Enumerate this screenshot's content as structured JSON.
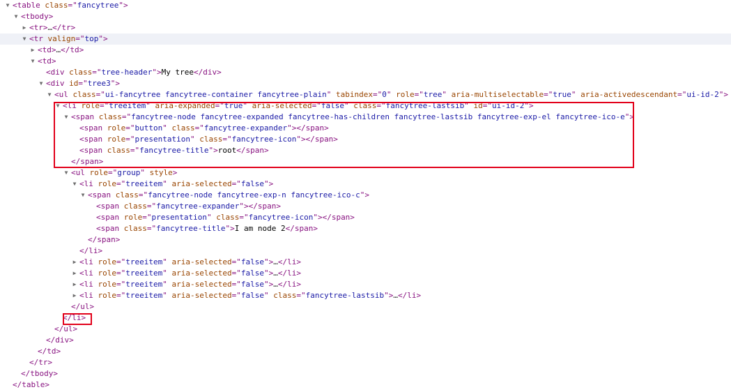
{
  "panel": "Elements",
  "highlight_color": "#e2001a",
  "colors": {
    "tag": "#881280",
    "attr_name": "#994500",
    "attr_value": "#1a1aa6",
    "text": "#000000",
    "selected_row_bg": "#eff1f7"
  },
  "nodes": [
    {
      "d": 0,
      "a": "open",
      "s": [
        [
          "t",
          "<table "
        ],
        [
          "n",
          "class"
        ],
        [
          "t",
          "=\""
        ],
        [
          "v",
          "fancytree"
        ],
        [
          "t",
          "\">"
        ]
      ]
    },
    {
      "d": 1,
      "a": "open",
      "s": [
        [
          "t",
          "<tbody>"
        ]
      ]
    },
    {
      "d": 2,
      "a": "closed",
      "s": [
        [
          "t",
          "<tr>"
        ],
        [
          "e",
          "…"
        ],
        [
          "t",
          "</tr>"
        ]
      ]
    },
    {
      "d": 2,
      "a": "open",
      "sel": true,
      "s": [
        [
          "t",
          "<tr "
        ],
        [
          "n",
          "valign"
        ],
        [
          "t",
          "=\""
        ],
        [
          "v",
          "top"
        ],
        [
          "t",
          "\">"
        ]
      ]
    },
    {
      "d": 3,
      "a": "closed",
      "s": [
        [
          "t",
          "<td>"
        ],
        [
          "e",
          "…"
        ],
        [
          "t",
          "</td>"
        ]
      ]
    },
    {
      "d": 3,
      "a": "open",
      "s": [
        [
          "t",
          "<td>"
        ]
      ]
    },
    {
      "d": 4,
      "a": "none",
      "s": [
        [
          "t",
          "<div "
        ],
        [
          "n",
          "class"
        ],
        [
          "t",
          "=\""
        ],
        [
          "v",
          "tree-header"
        ],
        [
          "t",
          "\">"
        ],
        [
          "x",
          "My tree"
        ],
        [
          "t",
          "</div>"
        ]
      ]
    },
    {
      "d": 4,
      "a": "open",
      "s": [
        [
          "t",
          "<div "
        ],
        [
          "n",
          "id"
        ],
        [
          "t",
          "=\""
        ],
        [
          "v",
          "tree3"
        ],
        [
          "t",
          "\">"
        ]
      ]
    },
    {
      "d": 5,
      "a": "open",
      "s": [
        [
          "t",
          "<ul "
        ],
        [
          "n",
          "class"
        ],
        [
          "t",
          "=\""
        ],
        [
          "v",
          "ui-fancytree fancytree-container fancytree-plain"
        ],
        [
          "t",
          "\" "
        ],
        [
          "n",
          "tabindex"
        ],
        [
          "t",
          "=\""
        ],
        [
          "v",
          "0"
        ],
        [
          "t",
          "\" "
        ],
        [
          "n",
          "role"
        ],
        [
          "t",
          "=\""
        ],
        [
          "v",
          "tree"
        ],
        [
          "t",
          "\" "
        ],
        [
          "n",
          "aria-multiselectable"
        ],
        [
          "t",
          "=\""
        ],
        [
          "v",
          "true"
        ],
        [
          "t",
          "\" "
        ],
        [
          "n",
          "aria-activedescendant"
        ],
        [
          "t",
          "=\""
        ],
        [
          "v",
          "ui-id-2"
        ],
        [
          "t",
          "\">"
        ]
      ]
    },
    {
      "d": 6,
      "a": "open",
      "s": [
        [
          "t",
          "<li "
        ],
        [
          "n",
          "role"
        ],
        [
          "t",
          "=\""
        ],
        [
          "v",
          "treeitem"
        ],
        [
          "t",
          "\" "
        ],
        [
          "n",
          "aria-expanded"
        ],
        [
          "t",
          "=\""
        ],
        [
          "v",
          "true"
        ],
        [
          "t",
          "\" "
        ],
        [
          "n",
          "aria-selected"
        ],
        [
          "t",
          "=\""
        ],
        [
          "v",
          "false"
        ],
        [
          "t",
          "\" "
        ],
        [
          "n",
          "class"
        ],
        [
          "t",
          "=\""
        ],
        [
          "v",
          "fancytree-lastsib"
        ],
        [
          "t",
          "\" "
        ],
        [
          "n",
          "id"
        ],
        [
          "t",
          "=\""
        ],
        [
          "v",
          "ui-id-2"
        ],
        [
          "t",
          "\">"
        ]
      ]
    },
    {
      "d": 7,
      "a": "open",
      "s": [
        [
          "t",
          "<span "
        ],
        [
          "n",
          "class"
        ],
        [
          "t",
          "=\""
        ],
        [
          "v",
          "fancytree-node fancytree-expanded fancytree-has-children fancytree-lastsib fancytree-exp-el fancytree-ico-e"
        ],
        [
          "t",
          "\">"
        ]
      ]
    },
    {
      "d": 8,
      "a": "none",
      "s": [
        [
          "t",
          "<span "
        ],
        [
          "n",
          "role"
        ],
        [
          "t",
          "=\""
        ],
        [
          "v",
          "button"
        ],
        [
          "t",
          "\" "
        ],
        [
          "n",
          "class"
        ],
        [
          "t",
          "=\""
        ],
        [
          "v",
          "fancytree-expander"
        ],
        [
          "t",
          "\"></span>"
        ]
      ]
    },
    {
      "d": 8,
      "a": "none",
      "s": [
        [
          "t",
          "<span "
        ],
        [
          "n",
          "role"
        ],
        [
          "t",
          "=\""
        ],
        [
          "v",
          "presentation"
        ],
        [
          "t",
          "\" "
        ],
        [
          "n",
          "class"
        ],
        [
          "t",
          "=\""
        ],
        [
          "v",
          "fancytree-icon"
        ],
        [
          "t",
          "\"></span>"
        ]
      ]
    },
    {
      "d": 8,
      "a": "none",
      "s": [
        [
          "t",
          "<span "
        ],
        [
          "n",
          "class"
        ],
        [
          "t",
          "=\""
        ],
        [
          "v",
          "fancytree-title"
        ],
        [
          "t",
          "\">"
        ],
        [
          "x",
          "root"
        ],
        [
          "t",
          "</span>"
        ]
      ]
    },
    {
      "d": 7,
      "a": "none",
      "s": [
        [
          "t",
          "</span>"
        ]
      ]
    },
    {
      "d": 7,
      "a": "open",
      "s": [
        [
          "t",
          "<ul "
        ],
        [
          "n",
          "role"
        ],
        [
          "t",
          "=\""
        ],
        [
          "v",
          "group"
        ],
        [
          "t",
          "\" "
        ],
        [
          "n",
          "style"
        ],
        [
          "t",
          ">"
        ]
      ]
    },
    {
      "d": 8,
      "a": "open",
      "s": [
        [
          "t",
          "<li "
        ],
        [
          "n",
          "role"
        ],
        [
          "t",
          "=\""
        ],
        [
          "v",
          "treeitem"
        ],
        [
          "t",
          "\" "
        ],
        [
          "n",
          "aria-selected"
        ],
        [
          "t",
          "=\""
        ],
        [
          "v",
          "false"
        ],
        [
          "t",
          "\">"
        ]
      ]
    },
    {
      "d": 9,
      "a": "open",
      "s": [
        [
          "t",
          "<span "
        ],
        [
          "n",
          "class"
        ],
        [
          "t",
          "=\""
        ],
        [
          "v",
          "fancytree-node fancytree-exp-n fancytree-ico-c"
        ],
        [
          "t",
          "\">"
        ]
      ]
    },
    {
      "d": 10,
      "a": "none",
      "s": [
        [
          "t",
          "<span "
        ],
        [
          "n",
          "class"
        ],
        [
          "t",
          "=\""
        ],
        [
          "v",
          "fancytree-expander"
        ],
        [
          "t",
          "\"></span>"
        ]
      ]
    },
    {
      "d": 10,
      "a": "none",
      "s": [
        [
          "t",
          "<span "
        ],
        [
          "n",
          "role"
        ],
        [
          "t",
          "=\""
        ],
        [
          "v",
          "presentation"
        ],
        [
          "t",
          "\" "
        ],
        [
          "n",
          "class"
        ],
        [
          "t",
          "=\""
        ],
        [
          "v",
          "fancytree-icon"
        ],
        [
          "t",
          "\"></span>"
        ]
      ]
    },
    {
      "d": 10,
      "a": "none",
      "s": [
        [
          "t",
          "<span "
        ],
        [
          "n",
          "class"
        ],
        [
          "t",
          "=\""
        ],
        [
          "v",
          "fancytree-title"
        ],
        [
          "t",
          "\">"
        ],
        [
          "x",
          "I am node 2"
        ],
        [
          "t",
          "</span>"
        ]
      ]
    },
    {
      "d": 9,
      "a": "none",
      "s": [
        [
          "t",
          "</span>"
        ]
      ]
    },
    {
      "d": 8,
      "a": "none",
      "s": [
        [
          "t",
          "</li>"
        ]
      ]
    },
    {
      "d": 8,
      "a": "closed",
      "s": [
        [
          "t",
          "<li "
        ],
        [
          "n",
          "role"
        ],
        [
          "t",
          "=\""
        ],
        [
          "v",
          "treeitem"
        ],
        [
          "t",
          "\" "
        ],
        [
          "n",
          "aria-selected"
        ],
        [
          "t",
          "=\""
        ],
        [
          "v",
          "false"
        ],
        [
          "t",
          "\">"
        ],
        [
          "e",
          "…"
        ],
        [
          "t",
          "</li>"
        ]
      ]
    },
    {
      "d": 8,
      "a": "closed",
      "s": [
        [
          "t",
          "<li "
        ],
        [
          "n",
          "role"
        ],
        [
          "t",
          "=\""
        ],
        [
          "v",
          "treeitem"
        ],
        [
          "t",
          "\" "
        ],
        [
          "n",
          "aria-selected"
        ],
        [
          "t",
          "=\""
        ],
        [
          "v",
          "false"
        ],
        [
          "t",
          "\">"
        ],
        [
          "e",
          "…"
        ],
        [
          "t",
          "</li>"
        ]
      ]
    },
    {
      "d": 8,
      "a": "closed",
      "s": [
        [
          "t",
          "<li "
        ],
        [
          "n",
          "role"
        ],
        [
          "t",
          "=\""
        ],
        [
          "v",
          "treeitem"
        ],
        [
          "t",
          "\" "
        ],
        [
          "n",
          "aria-selected"
        ],
        [
          "t",
          "=\""
        ],
        [
          "v",
          "false"
        ],
        [
          "t",
          "\">"
        ],
        [
          "e",
          "…"
        ],
        [
          "t",
          "</li>"
        ]
      ]
    },
    {
      "d": 8,
      "a": "closed",
      "s": [
        [
          "t",
          "<li "
        ],
        [
          "n",
          "role"
        ],
        [
          "t",
          "=\""
        ],
        [
          "v",
          "treeitem"
        ],
        [
          "t",
          "\" "
        ],
        [
          "n",
          "aria-selected"
        ],
        [
          "t",
          "=\""
        ],
        [
          "v",
          "false"
        ],
        [
          "t",
          "\" "
        ],
        [
          "n",
          "class"
        ],
        [
          "t",
          "=\""
        ],
        [
          "v",
          "fancytree-lastsib"
        ],
        [
          "t",
          "\">"
        ],
        [
          "e",
          "…"
        ],
        [
          "t",
          "</li>"
        ]
      ]
    },
    {
      "d": 7,
      "a": "none",
      "s": [
        [
          "t",
          "</ul>"
        ]
      ]
    },
    {
      "d": 6,
      "a": "none",
      "s": [
        [
          "t",
          "</li>"
        ]
      ]
    },
    {
      "d": 5,
      "a": "none",
      "s": [
        [
          "t",
          "</ul>"
        ]
      ]
    },
    {
      "d": 4,
      "a": "none",
      "s": [
        [
          "t",
          "</div>"
        ]
      ]
    },
    {
      "d": 3,
      "a": "none",
      "s": [
        [
          "t",
          "</td>"
        ]
      ]
    },
    {
      "d": 2,
      "a": "none",
      "s": [
        [
          "t",
          "</tr>"
        ]
      ]
    },
    {
      "d": 1,
      "a": "none",
      "s": [
        [
          "t",
          "</tbody>"
        ]
      ]
    },
    {
      "d": 0,
      "a": "none",
      "s": [
        [
          "t",
          "</table>"
        ]
      ]
    }
  ]
}
